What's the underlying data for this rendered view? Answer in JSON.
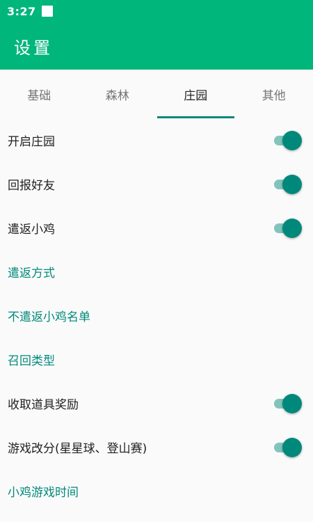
{
  "status_bar": {
    "time": "3:27"
  },
  "app_bar": {
    "title": "设置"
  },
  "tabs": [
    {
      "label": "基础",
      "active": false
    },
    {
      "label": "森林",
      "active": false
    },
    {
      "label": "庄园",
      "active": true
    },
    {
      "label": "其他",
      "active": false
    }
  ],
  "settings": [
    {
      "label": "开启庄园",
      "type": "switch",
      "checked": true
    },
    {
      "label": "回报好友",
      "type": "switch",
      "checked": true
    },
    {
      "label": "遣返小鸡",
      "type": "switch",
      "checked": true
    },
    {
      "label": "遣返方式",
      "type": "link"
    },
    {
      "label": "不遣返小鸡名单",
      "type": "link"
    },
    {
      "label": "召回类型",
      "type": "link"
    },
    {
      "label": "收取道具奖励",
      "type": "switch",
      "checked": true
    },
    {
      "label": "游戏改分(星星球、登山赛)",
      "type": "switch",
      "checked": true
    },
    {
      "label": "小鸡游戏时间",
      "type": "link"
    }
  ],
  "colors": {
    "primary": "#00b67a",
    "accent": "#00897b",
    "switch_track_on": "#80c4bd",
    "background": "#fafafa"
  }
}
